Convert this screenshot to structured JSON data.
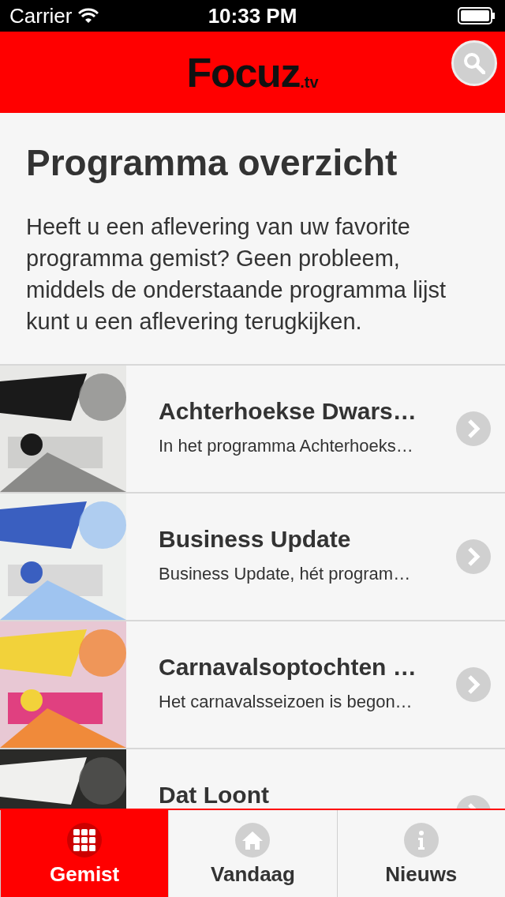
{
  "status_bar": {
    "carrier": "Carrier",
    "time": "10:33 PM"
  },
  "header": {
    "logo": "Focuz",
    "logo_suffix": ".tv"
  },
  "page": {
    "title": "Programma overzicht",
    "intro": "Heeft u een aflevering van uw favorite programma gemist? Geen probleem, middels de onderstaande programma lijst kunt u een aflevering terugkijken."
  },
  "programs": [
    {
      "title": "Achterhoekse Dwars…",
      "description": "In het programma Achterhoeks…"
    },
    {
      "title": "Business Update",
      "description": "Business Update, hét program…"
    },
    {
      "title": "Carnavalsoptochten …",
      "description": "Het carnavalsseizoen is begon…"
    },
    {
      "title": "Dat Loont"
    }
  ],
  "tabs": [
    {
      "label": "Gemist",
      "selected": true
    },
    {
      "label": "Vandaag",
      "selected": false
    },
    {
      "label": "Nieuws",
      "selected": false
    }
  ]
}
